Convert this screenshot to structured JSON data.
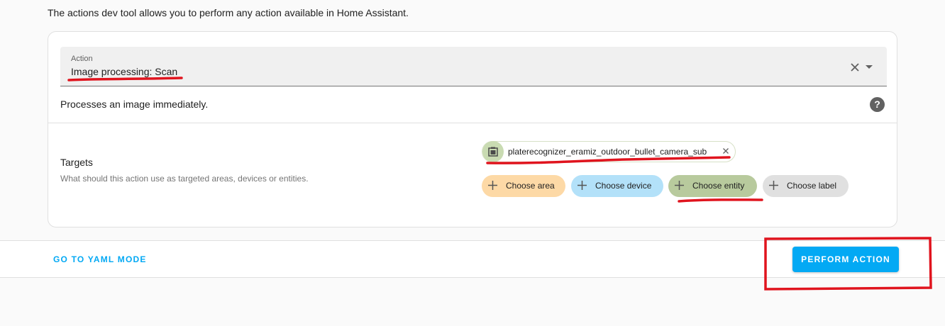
{
  "intro": "The actions dev tool allows you to perform any action available in Home Assistant.",
  "action": {
    "label": "Action",
    "value": "Image processing: Scan",
    "description": "Processes an image immediately.",
    "clear_icon": "close-icon",
    "dropdown_icon": "menu-down-icon",
    "help_icon": "help-circle-icon",
    "help_glyph": "?"
  },
  "targets": {
    "title": "Targets",
    "subtitle": "What should this action use as targeted areas, devices or entities.",
    "entity_chip": {
      "label": "platerecognizer_eramiz_outdoor_bullet_camera_sub",
      "icon": "image-icon",
      "remove_icon": "close-icon"
    },
    "buttons": [
      {
        "label": "Choose area",
        "color": "#fdd9a6"
      },
      {
        "label": "Choose device",
        "color": "#b3e1f9"
      },
      {
        "label": "Choose entity",
        "color": "#b8ca9d"
      },
      {
        "label": "Choose label",
        "color": "#e0e0e0"
      }
    ]
  },
  "footer": {
    "yaml_mode": "GO TO YAML MODE",
    "perform": "PERFORM ACTION"
  },
  "colors": {
    "primary": "#03a9f4",
    "annotation": "#e0141e"
  }
}
